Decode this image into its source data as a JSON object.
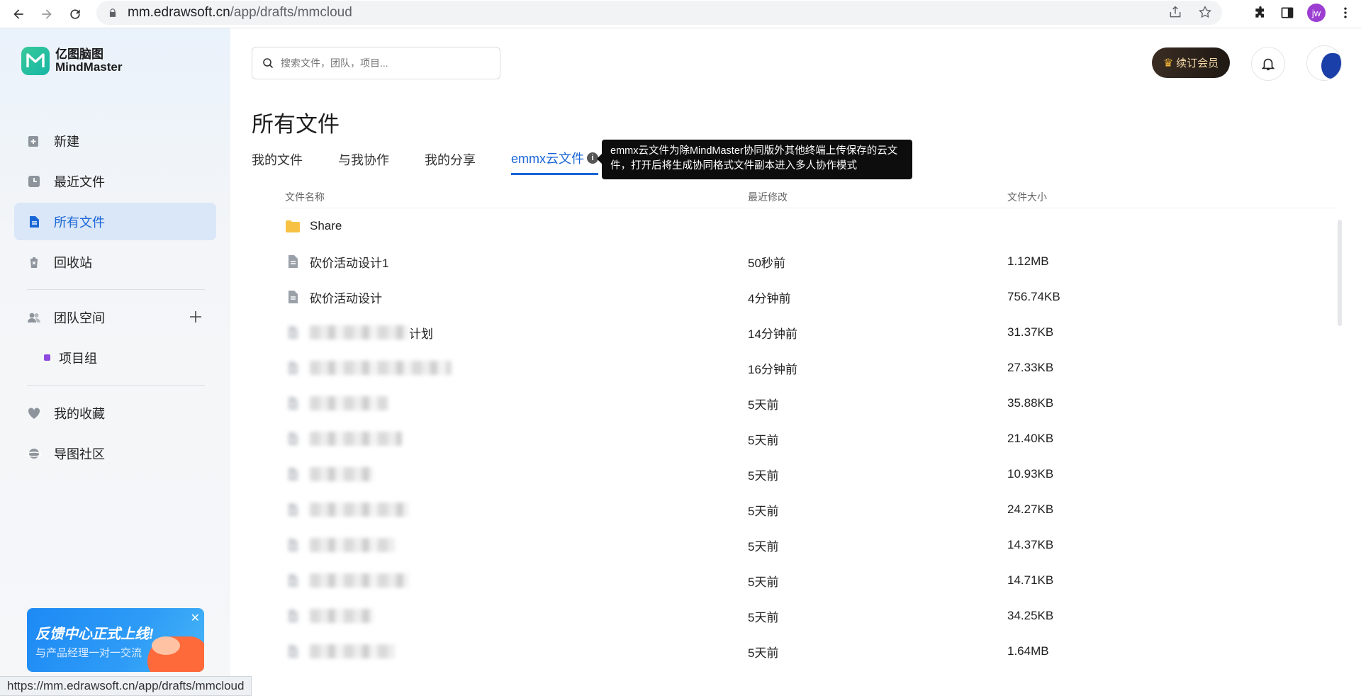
{
  "browser": {
    "url_host": "mm.edrawsoft.cn",
    "url_path": "/app/drafts/mmcloud",
    "profile_initials": "jw",
    "status_url": "https://mm.edrawsoft.cn/app/drafts/mmcloud"
  },
  "sidebar": {
    "logo_line1": "亿图脑图",
    "logo_line2": "MindMaster",
    "items": [
      {
        "label": "新建",
        "icon": "new-file-icon"
      },
      {
        "label": "最近文件",
        "icon": "clock-icon"
      },
      {
        "label": "所有文件",
        "icon": "file-icon"
      },
      {
        "label": "回收站",
        "icon": "trash-icon"
      }
    ],
    "team_space": "团队空间",
    "team_group": "项目组",
    "favorites": "我的收藏",
    "community": "导图社区",
    "promo_title": "反馈中心正式上线!",
    "promo_subtitle": "与产品经理一对一交流"
  },
  "header": {
    "search_placeholder": "搜索文件，团队，项目...",
    "renew_label": "续订会员"
  },
  "main": {
    "title": "所有文件",
    "tabs": [
      "我的文件",
      "与我协作",
      "我的分享",
      "emmx云文件"
    ],
    "tooltip": "emmx云文件为除MindMaster协同版外其他终端上传保存的云文件，打开后将生成协同格式文件副本进入多人协作模式",
    "columns": {
      "name": "文件名称",
      "modified": "最近修改",
      "size": "文件大小"
    },
    "rows": [
      {
        "name": "Share",
        "modified": "",
        "size": "",
        "type": "folder"
      },
      {
        "name": "砍价活动设计1",
        "modified": "50秒前",
        "size": "1.12MB",
        "type": "file"
      },
      {
        "name": "砍价活动设计",
        "modified": "4分钟前",
        "size": "756.74KB",
        "type": "file"
      },
      {
        "name": "计划",
        "modified": "14分钟前",
        "size": "31.37KB",
        "type": "blurred"
      },
      {
        "name": "",
        "modified": "16分钟前",
        "size": "27.33KB",
        "type": "blurred"
      },
      {
        "name": "",
        "modified": "5天前",
        "size": "35.88KB",
        "type": "blurred"
      },
      {
        "name": "",
        "modified": "5天前",
        "size": "21.40KB",
        "type": "blurred"
      },
      {
        "name": "",
        "modified": "5天前",
        "size": "10.93KB",
        "type": "blurred"
      },
      {
        "name": "",
        "modified": "5天前",
        "size": "24.27KB",
        "type": "blurred"
      },
      {
        "name": "",
        "modified": "5天前",
        "size": "14.37KB",
        "type": "blurred"
      },
      {
        "name": "",
        "modified": "5天前",
        "size": "14.71KB",
        "type": "blurred"
      },
      {
        "name": "",
        "modified": "5天前",
        "size": "34.25KB",
        "type": "blurred"
      },
      {
        "name": "",
        "modified": "5天前",
        "size": "1.64MB",
        "type": "blurred"
      }
    ]
  },
  "colors": {
    "accent": "#1a66d6",
    "active_bg": "#dae7f8",
    "folder": "#f7c244"
  }
}
